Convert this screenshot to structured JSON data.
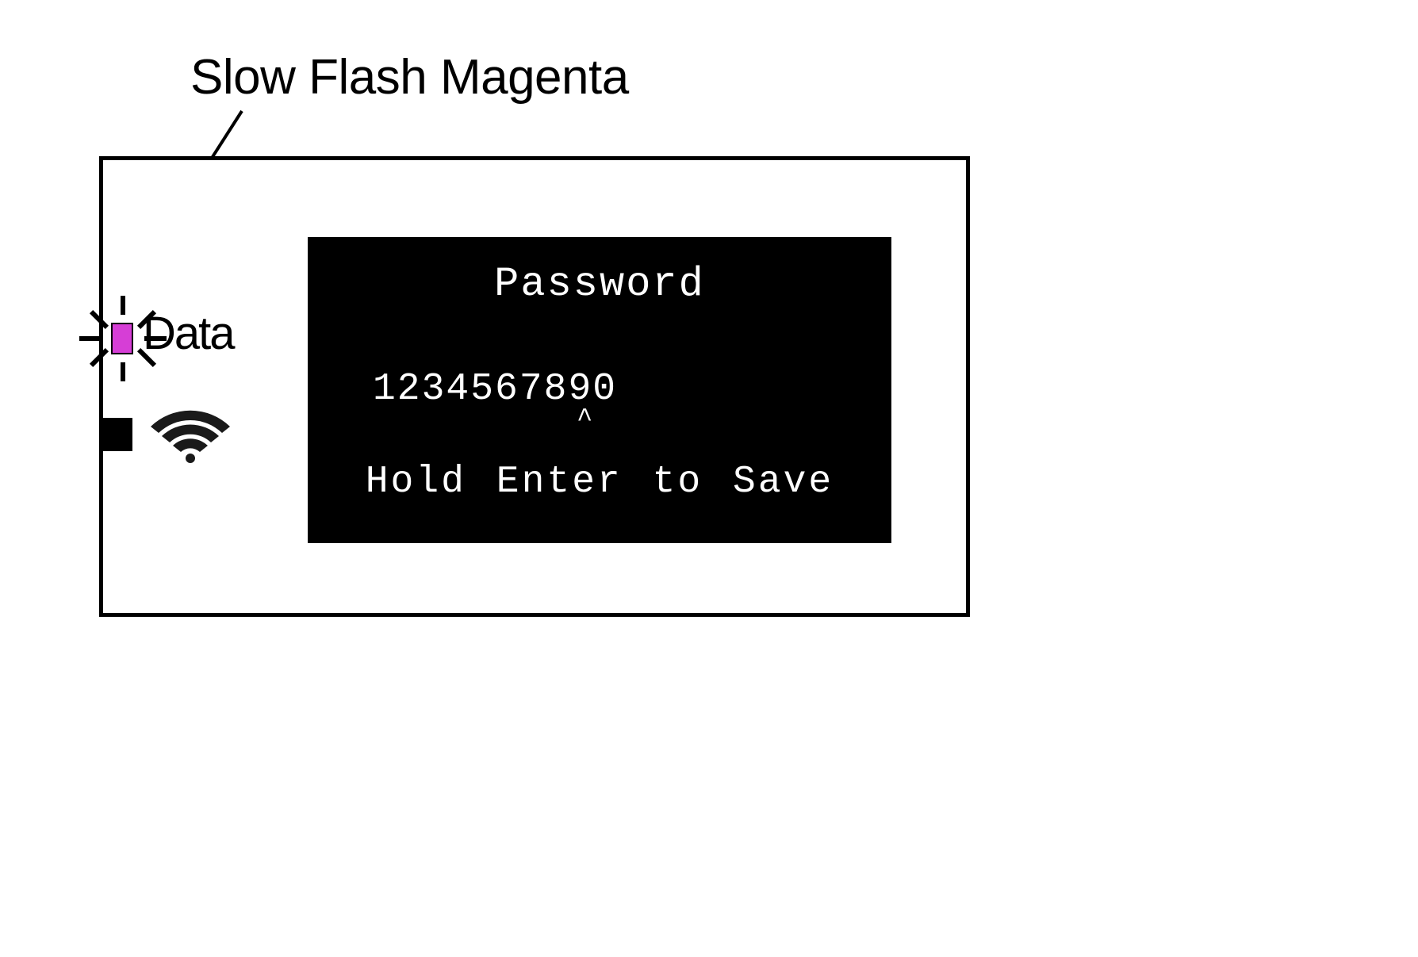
{
  "callout": {
    "label": "Slow Flash Magenta"
  },
  "led": {
    "label": "Data",
    "color": "#d63ed6"
  },
  "screen": {
    "title": "Password",
    "password_value": "1234567890",
    "cursor": "^",
    "instruction": "Hold Enter to Save"
  }
}
